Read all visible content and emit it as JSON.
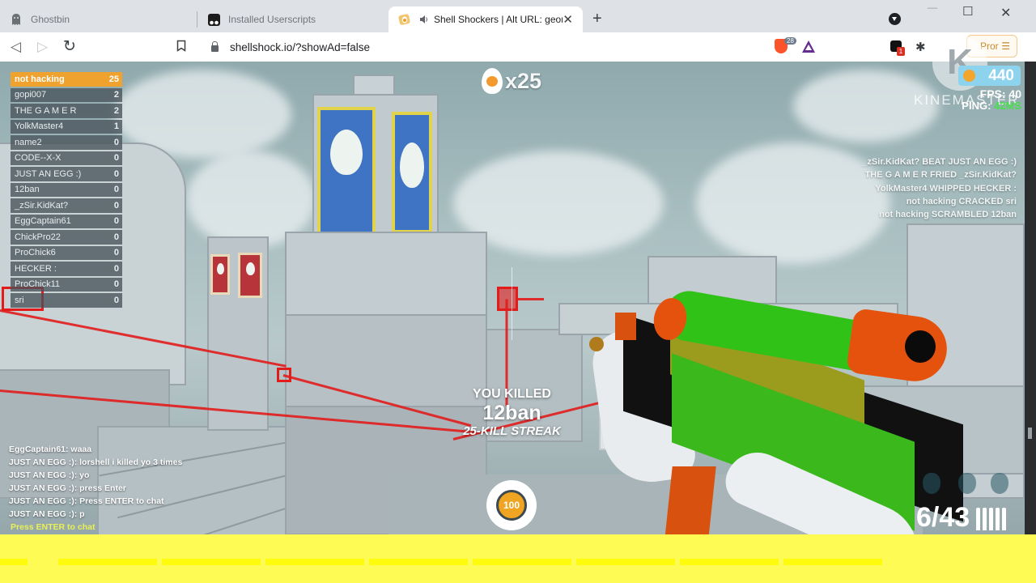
{
  "browser": {
    "tabs": [
      {
        "title": "Ghostbin",
        "icon": "ghost-icon",
        "active": false
      },
      {
        "title": "Installed Userscripts",
        "icon": "tampermonkey-icon",
        "active": false
      },
      {
        "title": "Shell Shockers | Alt URL: geom",
        "icon": "shell-shockers-icon",
        "active": true,
        "audio": true
      }
    ],
    "new_tab": "+",
    "close_tab": "✕",
    "window_controls": {
      "minimize": "—",
      "maximize": "☐",
      "close": "✕"
    },
    "nav": {
      "back": "◁",
      "forward": "▷",
      "reload": "↻",
      "bookmark": "🔖"
    },
    "url": "shellshock.io/?showAd=false",
    "brave_shield_count": "28",
    "extension_badge": "1",
    "profile_label": "Pror",
    "menu_icon": "☰"
  },
  "game": {
    "scoreboard": [
      {
        "name": "not hacking",
        "score": "25",
        "self": true
      },
      {
        "name": "gopi007",
        "score": "2"
      },
      {
        "name": "THE G A M E R",
        "score": "2"
      },
      {
        "name": "YolkMaster4",
        "score": "1"
      },
      {
        "name": "name2",
        "score": "0"
      },
      {
        "name": "CODE--X-X",
        "score": "0"
      },
      {
        "name": "JUST AN EGG :)",
        "score": "0"
      },
      {
        "name": "12ban",
        "score": "0"
      },
      {
        "name": "_zSir.KidKat?",
        "score": "0"
      },
      {
        "name": "EggCaptain61",
        "score": "0"
      },
      {
        "name": "ChickPro22",
        "score": "0"
      },
      {
        "name": "ProChick6",
        "score": "0"
      },
      {
        "name": "HECKER :",
        "score": "0"
      },
      {
        "name": "ProChick11",
        "score": "0"
      },
      {
        "name": "sri",
        "score": "0"
      }
    ],
    "kill_streak_count": "x25",
    "eggs": "440",
    "fps_label": "FPS: 40",
    "ping_label": "PING:",
    "ping_value": "42MS",
    "watermark": "KINEMASTER",
    "watermark_logo": "K",
    "kill_feed": [
      "_zSir.KidKat? BEAT JUST AN EGG :)",
      "THE G A M E R FRIED _zSir.KidKat?",
      "YolkMaster4 WHIPPED HECKER :",
      "not hacking CRACKED sri",
      "not hacking SCRAMBLED 12ban"
    ],
    "kill_message": {
      "line1": "YOU KILLED",
      "victim": "12ban",
      "streak": "25-KILL STREAK"
    },
    "chat": [
      "EggCaptain61: waaa",
      "JUST AN EGG :): lorshell i killed yo 3 times",
      "JUST AN EGG :): yo",
      "JUST AN EGG :): press Enter",
      "JUST AN EGG :): Press ENTER to chat",
      "JUST AN EGG :): p"
    ],
    "chat_prompt": "Press ENTER to chat",
    "health": "100",
    "ammo": "6/43",
    "grenades": 3,
    "colors": {
      "self_row": "#f0a22e",
      "laser": "#e21b1b",
      "ping_ok": "#48e04a",
      "chat_prompt": "#e9f154",
      "eggs_pill": "#8dd3ee"
    }
  }
}
